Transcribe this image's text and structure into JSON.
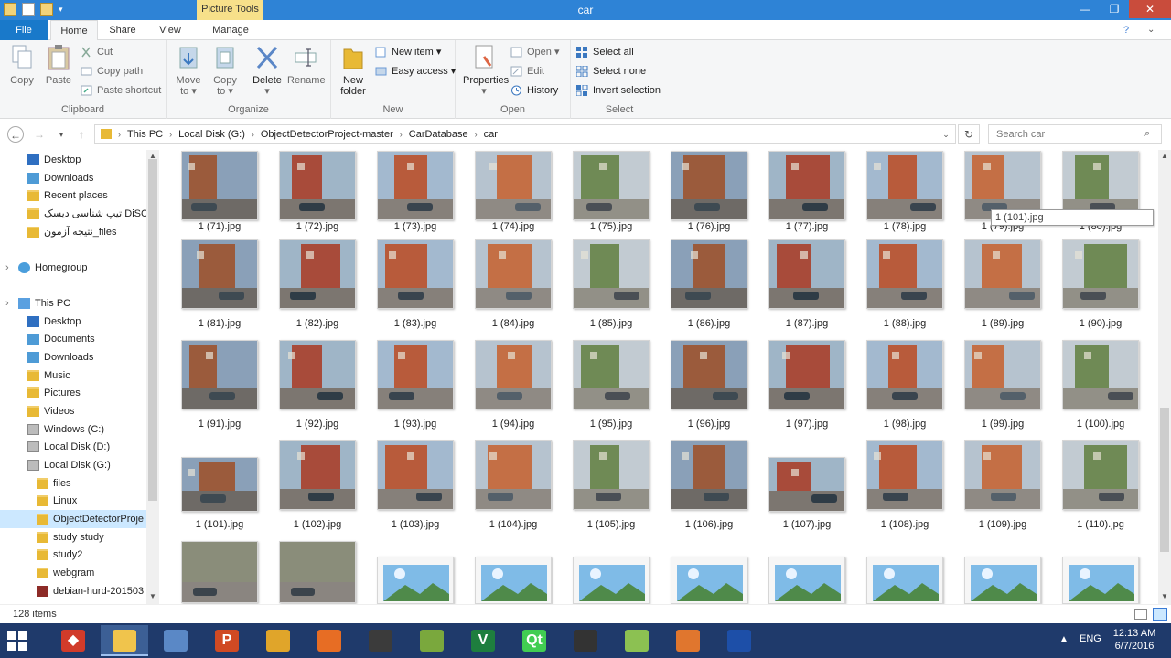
{
  "window": {
    "title": "car",
    "contextual_tab": "Picture Tools",
    "controls": {
      "minimize": "—",
      "maximize": "❐",
      "close": "✕"
    }
  },
  "ribbon_tabs": [
    "File",
    "Home",
    "Share",
    "View",
    "Manage"
  ],
  "ribbon": {
    "clipboard": {
      "label": "Clipboard",
      "copy": "Copy",
      "paste": "Paste",
      "cut": "Cut",
      "copy_path": "Copy path",
      "paste_shortcut": "Paste shortcut"
    },
    "organize": {
      "label": "Organize",
      "move_to_1": "Move",
      "move_to_2": "to ▾",
      "copy_to_1": "Copy",
      "copy_to_2": "to ▾",
      "delete_1": "Delete",
      "delete_2": "▾",
      "rename": "Rename"
    },
    "new": {
      "label": "New",
      "new_folder_1": "New",
      "new_folder_2": "folder",
      "new_item": "New item ▾",
      "easy_access": "Easy access ▾"
    },
    "open": {
      "label": "Open",
      "properties_1": "Properties",
      "properties_2": "▾",
      "open": "Open ▾",
      "edit": "Edit",
      "history": "History"
    },
    "select": {
      "label": "Select",
      "select_all": "Select all",
      "select_none": "Select none",
      "invert": "Invert selection"
    }
  },
  "nav_buttons": {
    "back": "←",
    "forward": "→",
    "recent": "▾",
    "up": "↑"
  },
  "breadcrumb": [
    "This PC",
    "Local Disk (G:)",
    "ObjectDetectorProject-master",
    "CarDatabase",
    "car"
  ],
  "breadcrumb_sep": "›",
  "address_dropdown": "⌄",
  "refresh": "↻",
  "search": {
    "placeholder": "Search car",
    "icon": "⌕"
  },
  "navpane": [
    {
      "label": "Desktop",
      "icon": "desktop-icon"
    },
    {
      "label": "Downloads",
      "icon": "downloads-icon"
    },
    {
      "label": "Recent places",
      "icon": "recent-places-icon"
    },
    {
      "label": "تیپ شناسی دیسک DiSC",
      "icon": "folder-icon"
    },
    {
      "label": "نتیجه آزمون_files",
      "icon": "folder-icon"
    },
    {
      "label": "Homegroup",
      "icon": "homegroup-icon"
    },
    {
      "label": "This PC",
      "icon": "pc-icon"
    },
    {
      "label": "Desktop",
      "icon": "desktop-icon"
    },
    {
      "label": "Documents",
      "icon": "documents-icon"
    },
    {
      "label": "Downloads",
      "icon": "downloads-icon"
    },
    {
      "label": "Music",
      "icon": "music-icon"
    },
    {
      "label": "Pictures",
      "icon": "pictures-icon"
    },
    {
      "label": "Videos",
      "icon": "videos-icon"
    },
    {
      "label": "Windows (C:)",
      "icon": "drive-icon"
    },
    {
      "label": "Local Disk (D:)",
      "icon": "drive-icon"
    },
    {
      "label": "Local Disk (G:)",
      "icon": "drive-icon"
    },
    {
      "label": "files",
      "icon": "folder-icon"
    },
    {
      "label": "Linux",
      "icon": "folder-icon"
    },
    {
      "label": "ObjectDetectorProje",
      "icon": "folder-icon"
    },
    {
      "label": "study study",
      "icon": "folder-icon"
    },
    {
      "label": "study2",
      "icon": "folder-icon"
    },
    {
      "label": "webgram",
      "icon": "folder-icon"
    },
    {
      "label": "debian-hurd-201503",
      "icon": "package-icon"
    }
  ],
  "files": [
    "1 (71).jpg",
    "1 (72).jpg",
    "1 (73).jpg",
    "1 (74).jpg",
    "1 (75).jpg",
    "1 (76).jpg",
    "1 (77).jpg",
    "1 (78).jpg",
    "1 (79).jpg",
    "1 (80).jpg",
    "1 (81).jpg",
    "1 (82).jpg",
    "1 (83).jpg",
    "1 (84).jpg",
    "1 (85).jpg",
    "1 (86).jpg",
    "1 (87).jpg",
    "1 (88).jpg",
    "1 (89).jpg",
    "1 (90).jpg",
    "1 (91).jpg",
    "1 (92).jpg",
    "1 (93).jpg",
    "1 (94).jpg",
    "1 (95).jpg",
    "1 (96).jpg",
    "1 (97).jpg",
    "1 (98).jpg",
    "1 (99).jpg",
    "1 (100).jpg",
    "1 (101).jpg",
    "1 (102).jpg",
    "1 (103).jpg",
    "1 (104).jpg",
    "1 (105).jpg",
    "1 (106).jpg",
    "1 (107).jpg",
    "1 (108).jpg",
    "1 (109).jpg",
    "1 (110).jpg"
  ],
  "tooltip": "1 (101).jpg",
  "status": {
    "count": "128 items"
  },
  "taskbar": {
    "apps": [
      "git-icon",
      "file-explorer-icon",
      "virtualbox-icon",
      "powerpoint-icon",
      "cmder-icon",
      "firefox-icon",
      "sublime-icon",
      "photo-editor-icon",
      "visual-studio-icon",
      "qt-icon",
      "python-icon",
      "android-studio-icon",
      "matlab-icon",
      "remote-desktop-icon"
    ],
    "app_labels": {
      "git": "◆",
      "powerpoint": "P",
      "qt": "Qt",
      "vs": "V"
    },
    "lang": "ENG",
    "time": "12:13 AM",
    "date": "6/7/2016",
    "tray_chevron": "▲"
  },
  "colors": {
    "titlebar": "#2e83d6",
    "file_tab": "#1979ca",
    "contextual_tab": "#f7e08a",
    "taskbar": "#1f3a6b",
    "selection": "#cce8ff"
  }
}
